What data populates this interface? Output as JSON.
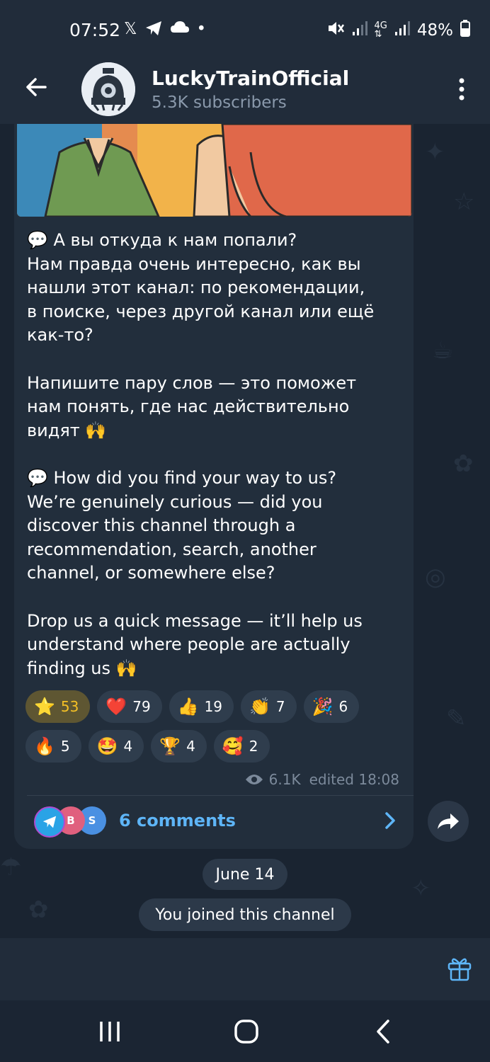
{
  "status_bar": {
    "time": "07:52",
    "left_icons": [
      "x-icon",
      "telegram-icon",
      "cloud-icon",
      "dot-icon"
    ],
    "battery": "48%"
  },
  "header": {
    "title": "LuckyTrainOfficial",
    "subtitle": "5.3K subscribers"
  },
  "message": {
    "ru_paragraph1": [
      "💬 А вы откуда к нам попали?",
      "Нам правда очень интересно, как вы",
      "нашли этот канал: по рекомендации,",
      "в поиске, через другой канал или ещё",
      "как-то?"
    ],
    "ru_paragraph2": [
      "Напишите пару слов — это поможет",
      "нам понять, где нас действительно",
      "видят 🙌"
    ],
    "en_paragraph1": [
      "💬 How did you find your way to us?",
      "We’re genuinely curious — did you",
      "discover this channel through a",
      "recommendation, search, another",
      "channel, or somewhere else?"
    ],
    "en_paragraph2": [
      "Drop us a quick message — it’ll help us",
      "understand where people are actually",
      "finding us 🙌"
    ],
    "views": "6.1K",
    "edited": "edited 18:08"
  },
  "reactions": [
    {
      "emoji": "⭐",
      "count": "53"
    },
    {
      "emoji": "❤️",
      "count": "79"
    },
    {
      "emoji": "👍",
      "count": "19"
    },
    {
      "emoji": "👏",
      "count": "7"
    },
    {
      "emoji": "🎉",
      "count": "6"
    },
    {
      "emoji": "🔥",
      "count": "5"
    },
    {
      "emoji": "🤩",
      "count": "4"
    },
    {
      "emoji": "🏆",
      "count": "4"
    },
    {
      "emoji": "🥰",
      "count": "2"
    }
  ],
  "comments": {
    "label": "6 comments",
    "avatars": [
      "",
      "B",
      "S"
    ]
  },
  "service": {
    "date": "June 14",
    "joined": "You joined this channel"
  },
  "colors": {
    "accent": "#5eb5f7",
    "star_chip": "#5e5632",
    "star_text": "#f4c025"
  }
}
